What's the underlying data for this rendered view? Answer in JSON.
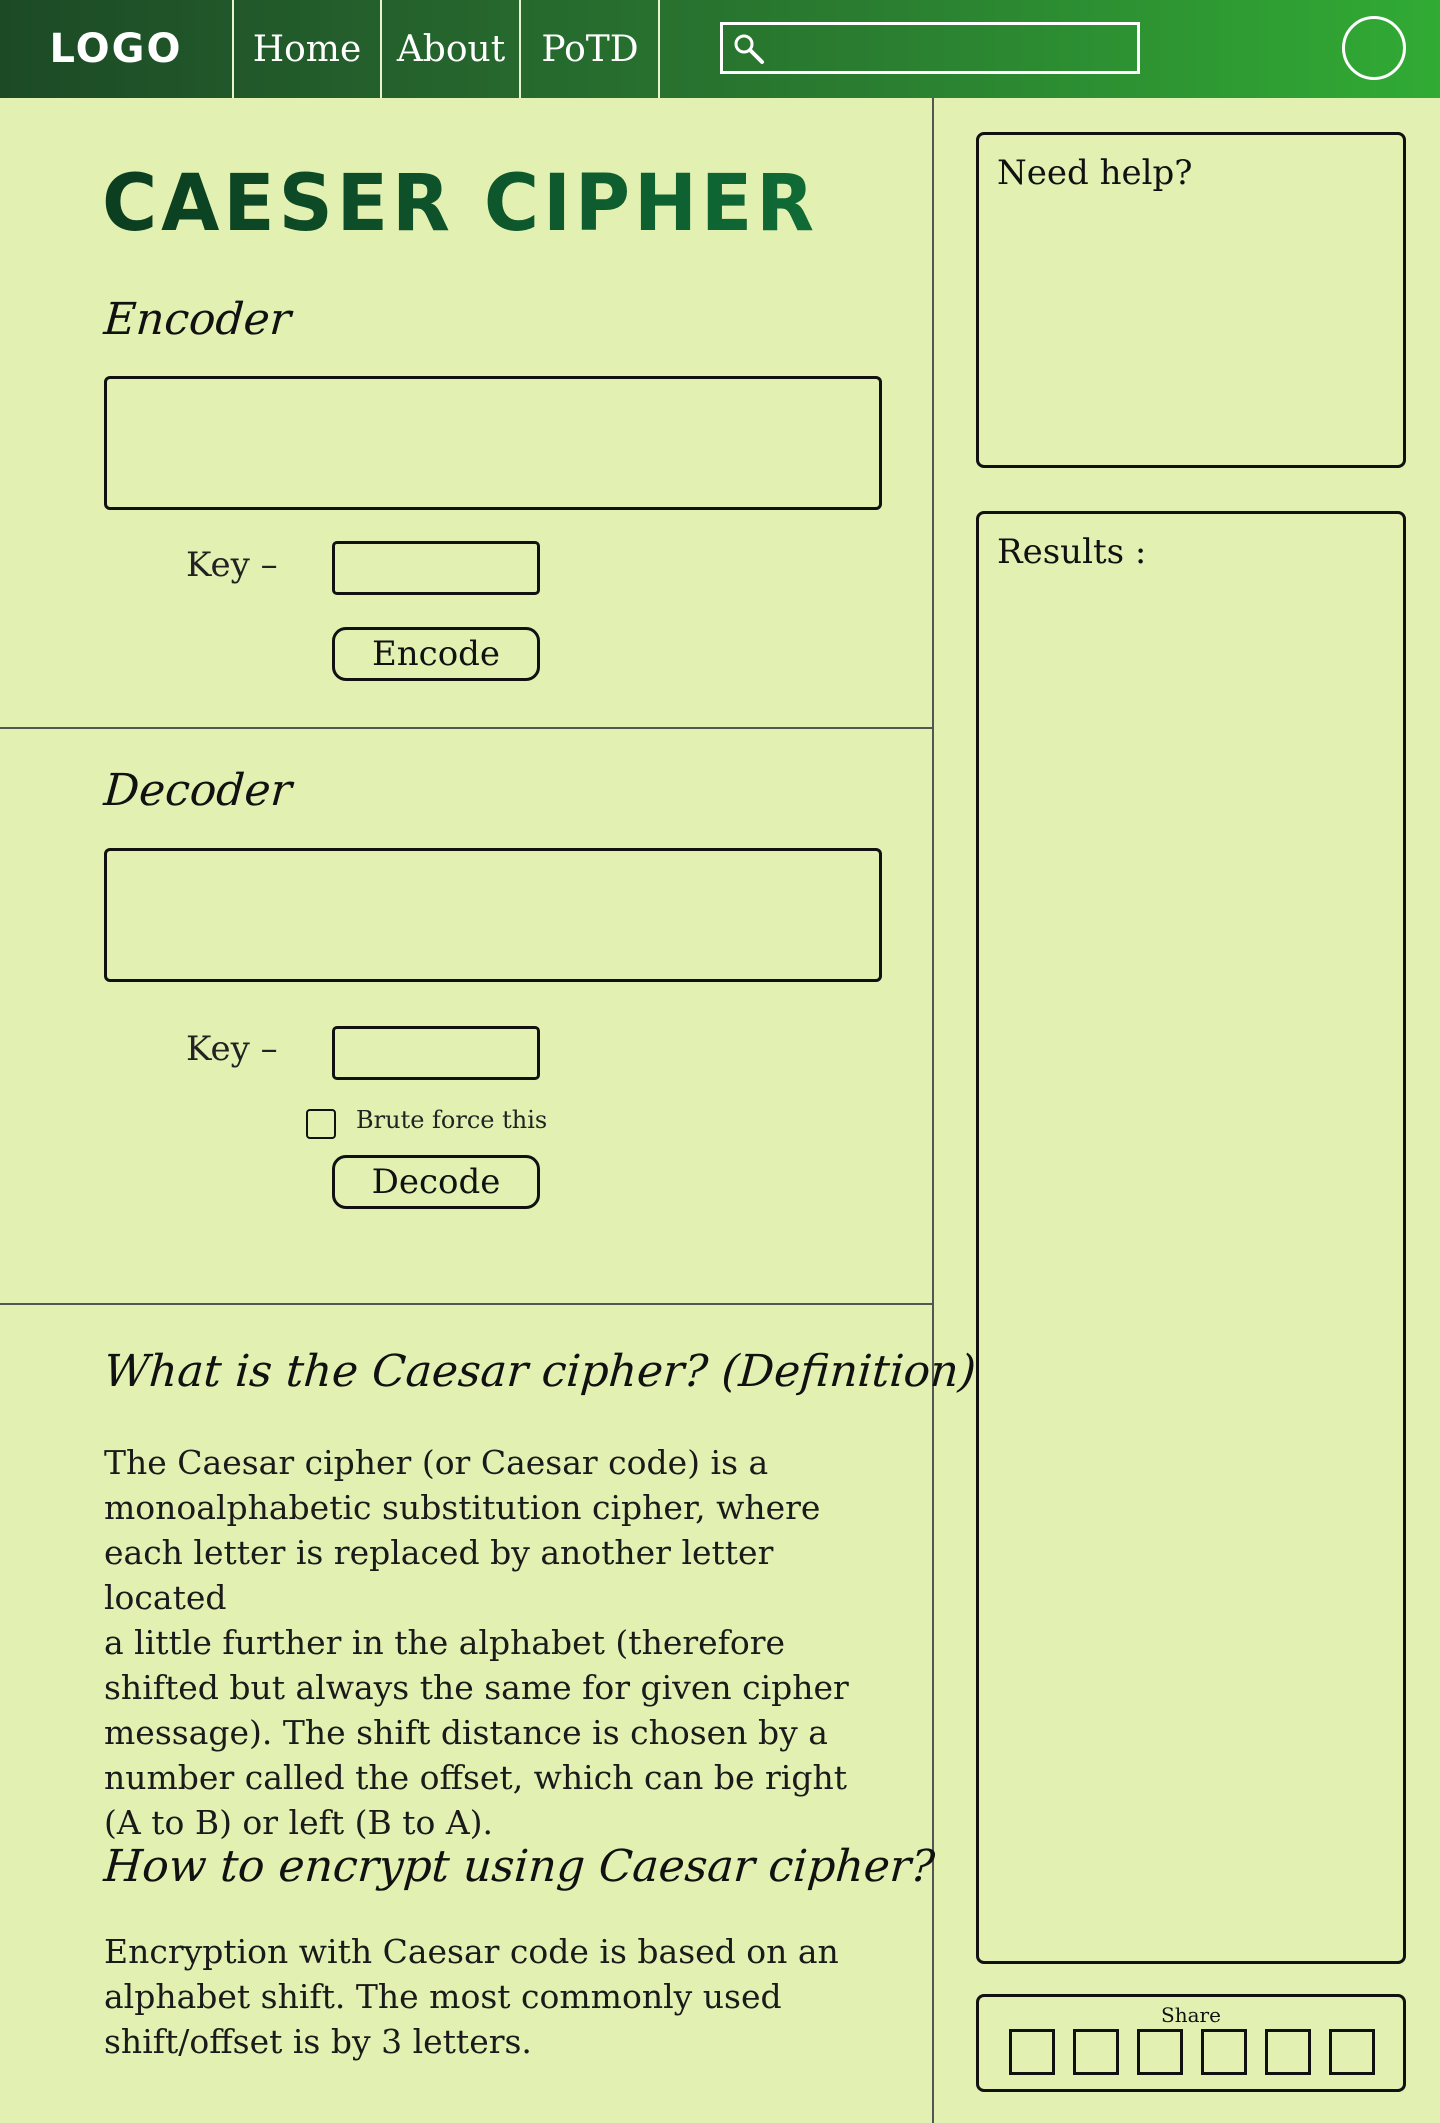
{
  "nav": {
    "logo": "LOGO",
    "items": [
      {
        "label": "Home"
      },
      {
        "label": "About"
      },
      {
        "label": "PoTD"
      }
    ],
    "search_placeholder": ""
  },
  "main": {
    "title": "CAESER CIPHER",
    "encoder": {
      "heading": "Encoder",
      "key_label": "Key –",
      "button_label": "Encode"
    },
    "decoder": {
      "heading": "Decoder",
      "key_label": "Key –",
      "checkbox_label": "Brute force this",
      "button_label": "Decode"
    },
    "definition": {
      "heading": "What is the Caesar cipher? (Definition)",
      "lines": [
        "The Caesar cipher (or Caesar code) is a",
        "monoalphabetic substitution cipher, where",
        "each letter is replaced by another letter located",
        "a little further in the alphabet (therefore",
        "shifted but always the same for given cipher",
        "message). The shift distance is chosen by a",
        "number called the offset, which can be right",
        "(A to B) or left (B to A)."
      ]
    },
    "encrypt": {
      "heading": "How to encrypt using Caesar cipher?",
      "lines": [
        "Encryption with Caesar code is based on an",
        "alphabet shift. The most commonly used",
        "shift/offset is by 3 letters."
      ]
    }
  },
  "sidebar": {
    "help_title": "Need help?",
    "results_title": "Results :",
    "share_label": "Share"
  },
  "colors": {
    "background": "#e2f1b1",
    "nav_start": "#1c4a25",
    "nav_end": "#31ab34",
    "title_green": "#0f5a2e"
  },
  "icons": [
    "search-icon",
    "avatar-icon"
  ]
}
